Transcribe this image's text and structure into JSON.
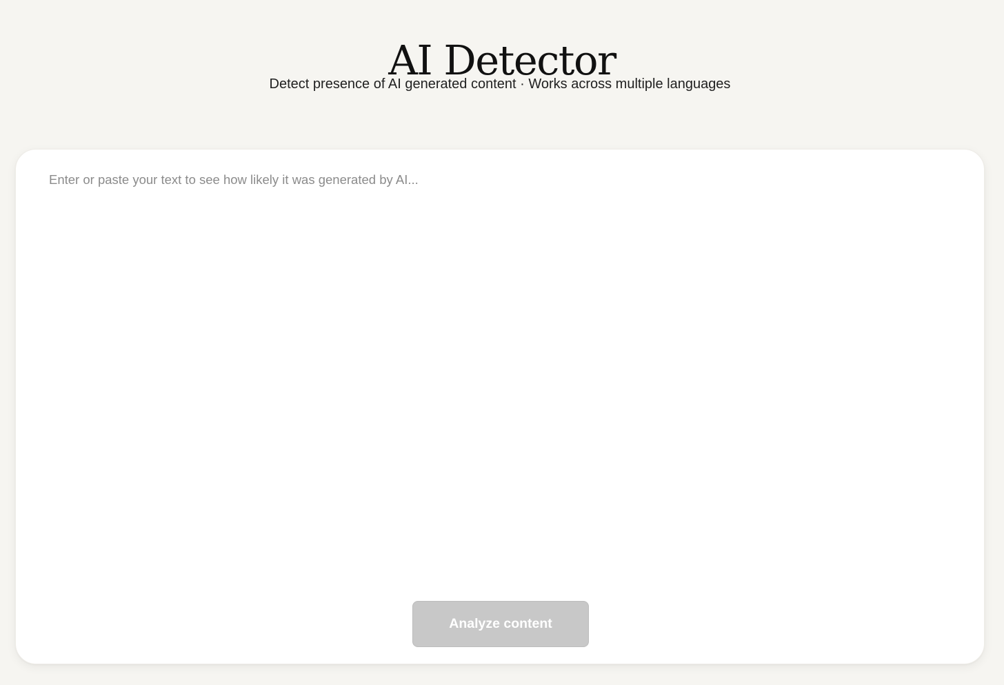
{
  "header": {
    "title": "AI Detector",
    "subtitle": "Detect presence of AI generated content · Works across multiple languages"
  },
  "editor": {
    "value": "",
    "placeholder": "Enter or paste your text to see how likely it was generated by AI..."
  },
  "actions": {
    "analyze_label": "Analyze content",
    "analyze_disabled": true
  },
  "colors": {
    "page_background": "#f6f5f1",
    "card_background": "#ffffff",
    "button_disabled": "#c8c8c8",
    "placeholder_text": "#8b8b8b"
  }
}
